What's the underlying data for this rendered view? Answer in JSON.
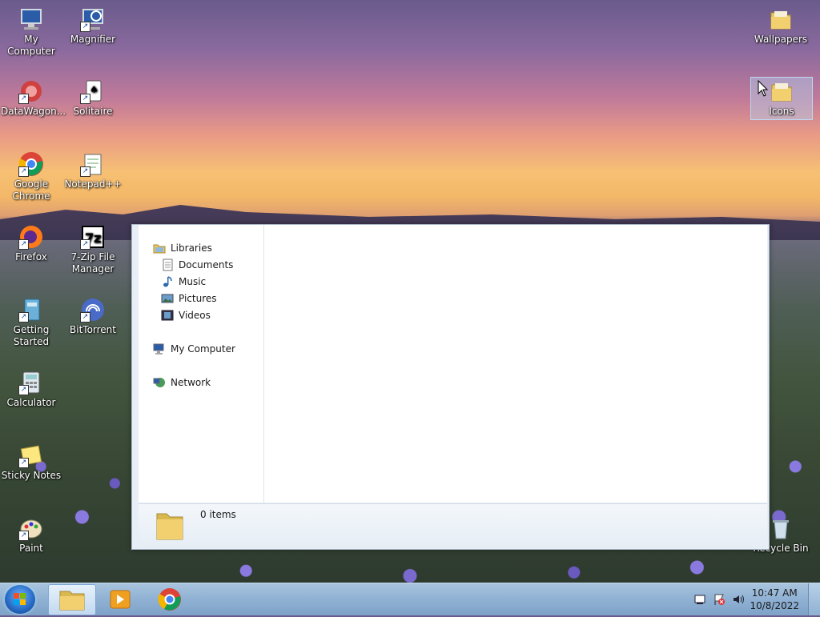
{
  "desktop": {
    "icons_left": [
      {
        "label": "My Computer"
      },
      {
        "label": "Magnifier"
      },
      {
        "label": "DataWagon..."
      },
      {
        "label": "Solitaire"
      },
      {
        "label": "Google Chrome"
      },
      {
        "label": "Notepad++"
      },
      {
        "label": "Firefox"
      },
      {
        "label": "7-Zip File Manager"
      },
      {
        "label": "Getting Started"
      },
      {
        "label": "BitTorrent"
      },
      {
        "label": "Calculator"
      },
      {
        "label": "Sticky Notes"
      },
      {
        "label": "Paint"
      }
    ],
    "icons_right": [
      {
        "label": "Wallpapers"
      },
      {
        "label": "Icons"
      },
      {
        "label": "Recycle Bin"
      }
    ]
  },
  "explorer": {
    "nav": {
      "libraries": "Libraries",
      "documents": "Documents",
      "music": "Music",
      "pictures": "Pictures",
      "videos": "Videos",
      "computer": "My Computer",
      "network": "Network"
    },
    "details": {
      "item_count": "0 items"
    }
  },
  "taskbar": {
    "time": "10:47 AM",
    "date": "10/8/2022"
  }
}
